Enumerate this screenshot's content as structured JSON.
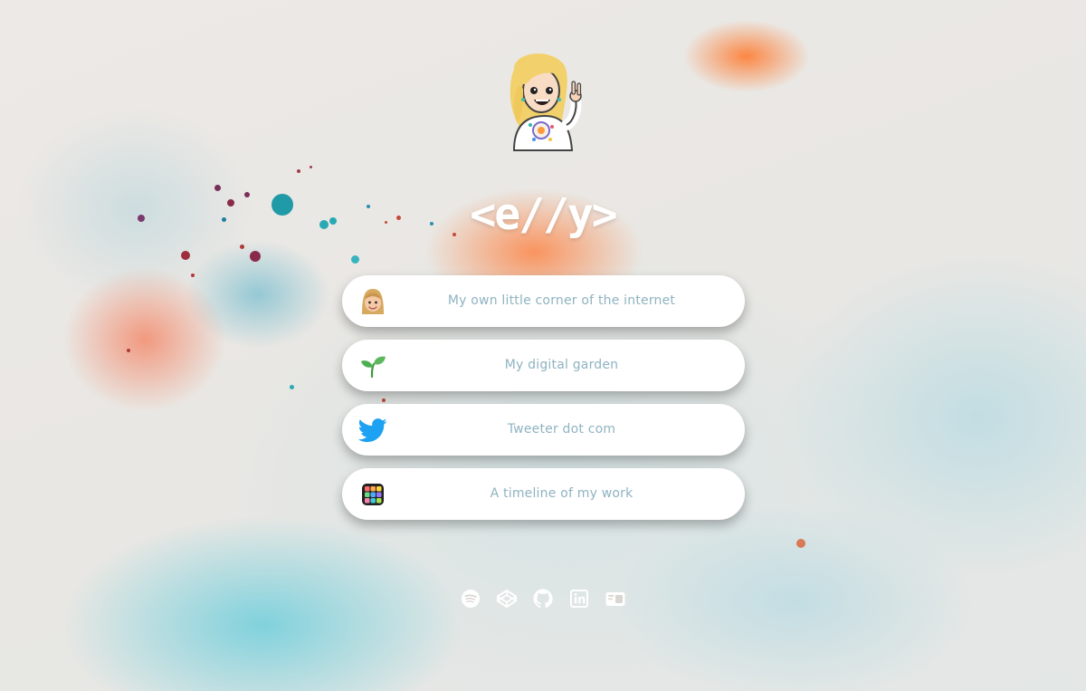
{
  "brand": {
    "logo_text": "<e//y>"
  },
  "avatar": {
    "icon": "memoji-avatar-icon"
  },
  "links": [
    {
      "label": "My own little corner of the internet",
      "icon": "memoji-face-icon"
    },
    {
      "label": "My digital garden",
      "icon": "seedling-icon"
    },
    {
      "label": "Tweeter dot com",
      "icon": "twitter-bird-icon"
    },
    {
      "label": "A timeline of my work",
      "icon": "color-grid-icon"
    }
  ],
  "socials": [
    {
      "icon": "spotify-icon"
    },
    {
      "icon": "codepen-icon"
    },
    {
      "icon": "github-icon"
    },
    {
      "icon": "linkedin-icon"
    },
    {
      "icon": "blog-icon"
    }
  ],
  "colors": {
    "link_text": "#8fb3c1",
    "twitter_blue": "#1da1f2",
    "logo": "#ffffff"
  }
}
